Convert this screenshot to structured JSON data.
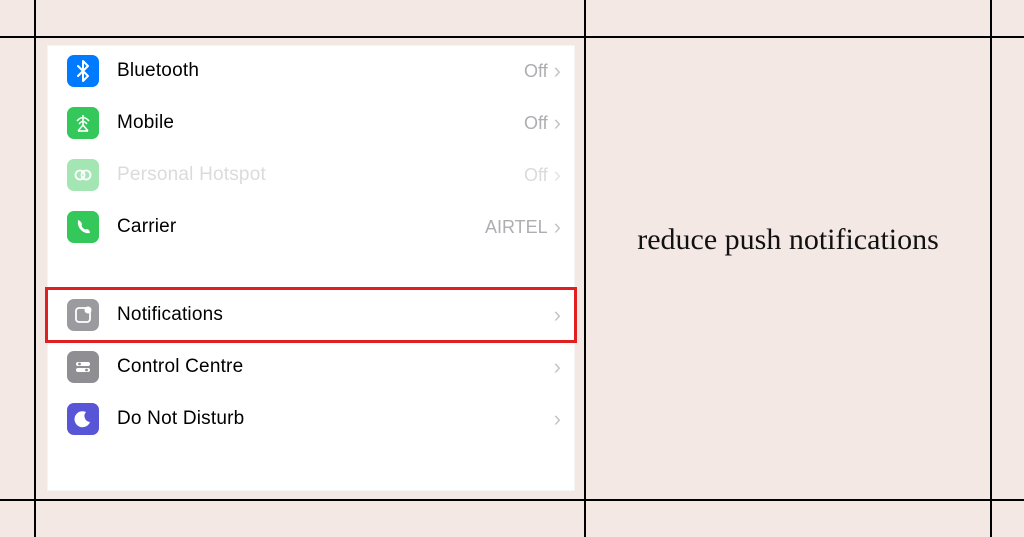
{
  "caption": "reduce push notifications",
  "settings": {
    "group1": [
      {
        "icon": "bluetooth",
        "label": "Bluetooth",
        "value": "Off",
        "disabled": false
      },
      {
        "icon": "mobile",
        "label": "Mobile",
        "value": "Off",
        "disabled": false
      },
      {
        "icon": "hotspot",
        "label": "Personal Hotspot",
        "value": "Off",
        "disabled": true
      },
      {
        "icon": "carrier",
        "label": "Carrier",
        "value": "AIRTEL",
        "disabled": false
      }
    ],
    "group2": [
      {
        "icon": "notifications",
        "label": "Notifications",
        "value": "",
        "highlight": true
      },
      {
        "icon": "control",
        "label": "Control Centre",
        "value": ""
      },
      {
        "icon": "dnd",
        "label": "Do Not Disturb",
        "value": ""
      }
    ]
  },
  "colors": {
    "bluetooth": "#007aff",
    "mobile": "#34c759",
    "hotspot": "#34c759",
    "carrier": "#34c759",
    "notifications": "#9b9b9f",
    "control": "#8e8e93",
    "dnd": "#5856d6"
  }
}
